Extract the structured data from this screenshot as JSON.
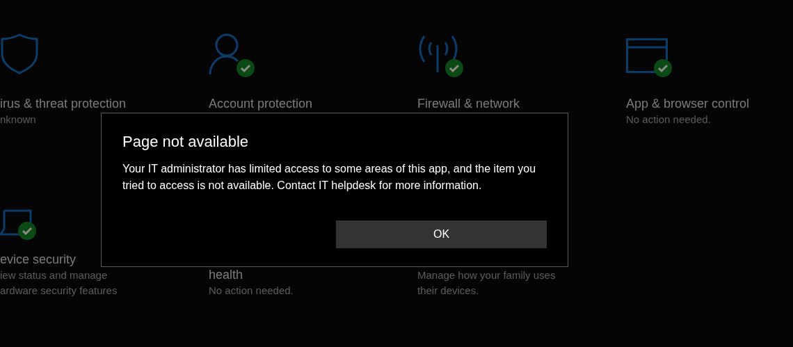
{
  "tiles": [
    {
      "verified": false,
      "title": "irus & threat protection",
      "subtitle": "nknown"
    },
    {
      "verified": true,
      "title": "Account protection"
    },
    {
      "verified": true,
      "title": "Firewall & network"
    },
    {
      "verified": true,
      "title": "App & browser control",
      "subtitle": "No action needed."
    },
    {
      "verified": true,
      "title": "evice security",
      "subtitle": "iew status and manage\nardware security features"
    },
    {
      "title": "health",
      "subtitle": "No action needed."
    },
    {
      "subtitle": "Manage how your family uses\ntheir devices."
    }
  ],
  "dialog": {
    "title": "Page not available",
    "message": "Your IT administrator has limited access to some areas of this app, and the item you tried to access is not available. Contact IT helpdesk for more information.",
    "button": "OK"
  }
}
